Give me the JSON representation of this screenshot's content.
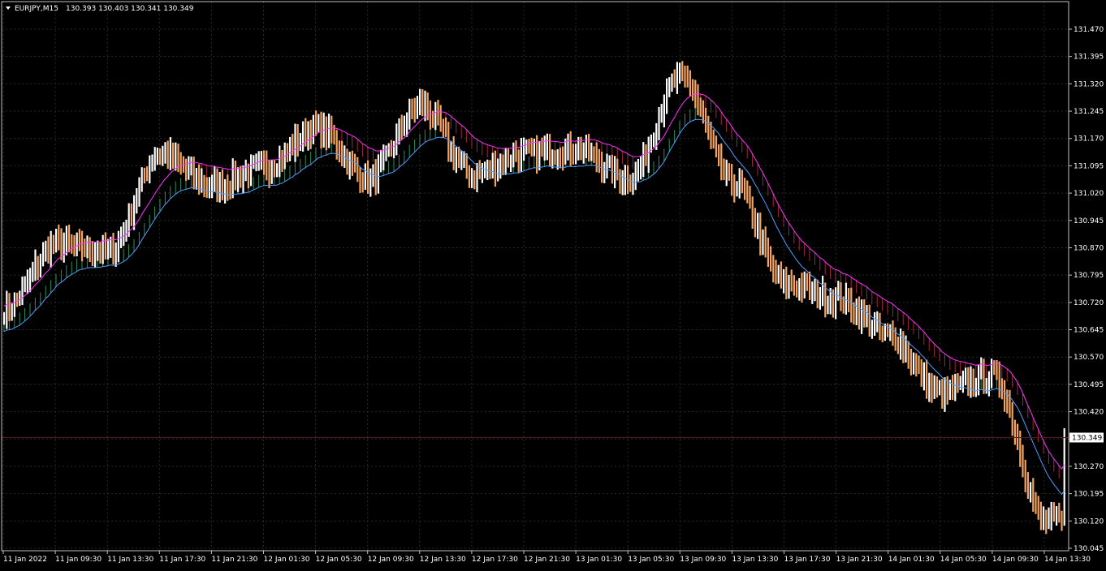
{
  "window": {
    "symbol_timeframe": "EURJPY,M15",
    "ohlc_readout": "130.393 130.403 130.341 130.349",
    "collapse_icon": "triangle-down-icon"
  },
  "price_axis": {
    "ticks": [
      "131.470",
      "131.395",
      "131.320",
      "131.245",
      "131.170",
      "131.095",
      "131.020",
      "130.945",
      "130.870",
      "130.795",
      "130.720",
      "130.645",
      "130.570",
      "130.495",
      "130.420",
      "130.345",
      "130.270",
      "130.195",
      "130.120",
      "130.045"
    ],
    "current_price_label": "130.349"
  },
  "time_axis": {
    "ticks": [
      "11 Jan 2022",
      "11 Jan 09:30",
      "11 Jan 13:30",
      "11 Jan 17:30",
      "11 Jan 21:30",
      "12 Jan 01:30",
      "12 Jan 05:30",
      "12 Jan 09:30",
      "12 Jan 13:30",
      "12 Jan 17:30",
      "12 Jan 21:30",
      "13 Jan 01:30",
      "13 Jan 05:30",
      "13 Jan 09:30",
      "13 Jan 13:30",
      "13 Jan 17:30",
      "13 Jan 21:30",
      "14 Jan 01:30",
      "14 Jan 05:30",
      "14 Jan 09:30",
      "14 Jan 13:30"
    ]
  },
  "colors": {
    "background": "#000000",
    "frame": "#c0c0c0",
    "grid": "#2a2a2a",
    "bull_bar": "#ffffff",
    "bear_bar": "#f4a460",
    "upper_band": "#ff33ff",
    "lower_band": "#4d9fff",
    "bull_cloud": "#3cb371",
    "bear_cloud": "#cc3344",
    "price_line": "#5a1a1a",
    "text": "#ffffff"
  },
  "chart_data": {
    "type": "bar",
    "symbol": "EURJPY",
    "timeframe": "M15",
    "ylim": [
      130.045,
      131.47
    ],
    "grid": true,
    "current_price": 130.349,
    "anchors": [
      [
        "11 Jan 2022",
        130.7
      ],
      [
        "11 Jan 09:30",
        130.88
      ],
      [
        "11 Jan 13:30",
        130.86
      ],
      [
        "11 Jan 17:30",
        131.13
      ],
      [
        "11 Jan 21:30",
        131.04
      ],
      [
        "12 Jan 01:30",
        131.09
      ],
      [
        "12 Jan 05:30",
        131.2
      ],
      [
        "12 Jan 09:30",
        131.06
      ],
      [
        "12 Jan 13:30",
        131.26
      ],
      [
        "12 Jan 17:30",
        131.07
      ],
      [
        "12 Jan 21:30",
        131.13
      ],
      [
        "13 Jan 01:30",
        131.14
      ],
      [
        "13 Jan 05:30",
        131.06
      ],
      [
        "13 Jan 09:30",
        131.34
      ],
      [
        "13 Jan 13:30",
        131.05
      ],
      [
        "13 Jan 17:30",
        130.77
      ],
      [
        "13 Jan 21:30",
        130.73
      ],
      [
        "14 Jan 01:30",
        130.63
      ],
      [
        "14 Jan 05:30",
        130.47
      ],
      [
        "14 Jan 09:30",
        130.52
      ],
      [
        "14 Jan 13:30",
        130.12
      ]
    ]
  }
}
